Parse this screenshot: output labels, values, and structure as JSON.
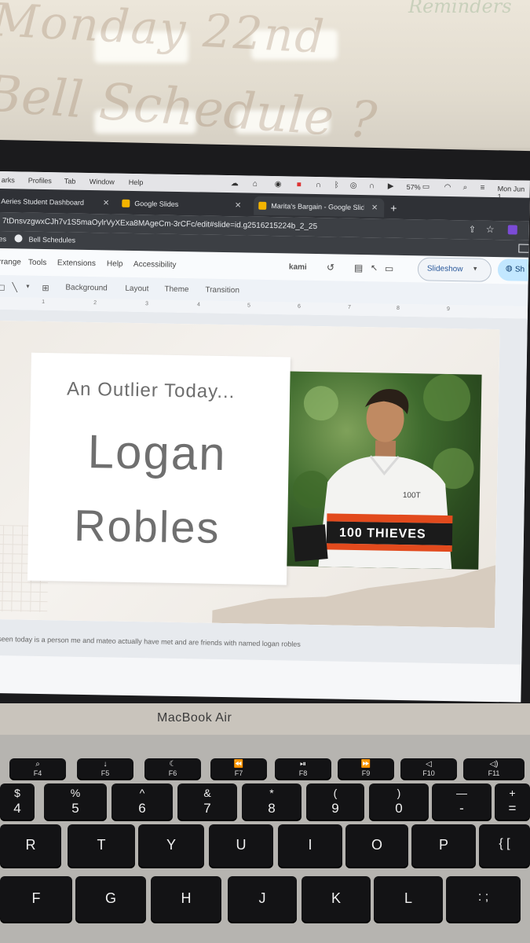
{
  "whiteboard": {
    "line1": "Monday 22nd",
    "line2": "Bell Schedule ?",
    "corner": "Reminders"
  },
  "menubar": {
    "items": [
      "arks",
      "Profiles",
      "Tab",
      "Window",
      "Help"
    ],
    "battery": "57%",
    "clock": "Mon Jun 1"
  },
  "tabs": [
    {
      "label": "Aeries Student Dashboard"
    },
    {
      "label": "Google Slides"
    },
    {
      "label": "Marita's Bargain - Google Slide"
    }
  ],
  "address_bar": {
    "url": "7tDnsvzgwxCJh7v1S5maOylrVyXExa8MAgeCm-3rCFc/edit#slide=id.g2516215224b_2_25"
  },
  "bookmarks": [
    {
      "label": "es"
    },
    {
      "label": "Bell Schedules"
    }
  ],
  "slides_menu": {
    "items": [
      "rrange",
      "Tools",
      "Extensions",
      "Help",
      "Accessibility"
    ],
    "kami": "kami",
    "slideshow": "Slideshow",
    "share": "Sh"
  },
  "toolbar": {
    "items": [
      "Background",
      "Layout",
      "Theme",
      "Transition"
    ]
  },
  "ruler": {
    "numbers": [
      "1",
      "2",
      "3",
      "4",
      "5",
      "6",
      "7",
      "8",
      "9"
    ]
  },
  "slide": {
    "subtitle": "An Outlier Today...",
    "name_first": "Logan",
    "name_last": "Robles",
    "photo_jersey_text": "100 THIEVES",
    "photo_logo_text": "100T"
  },
  "speaker_notes": "e seen today is a person me and mateo actually have met and are friends with named logan robles",
  "laptop": {
    "model": "MacBook Air"
  },
  "keyboard": {
    "fn_row": [
      {
        "glyph": "⌕",
        "label": "F4"
      },
      {
        "glyph": "↓",
        "label": "F5"
      },
      {
        "glyph": "☾",
        "label": "F6"
      },
      {
        "glyph": "⏪",
        "label": "F7"
      },
      {
        "glyph": "⏯",
        "label": "F8"
      },
      {
        "glyph": "⏩",
        "label": "F9"
      },
      {
        "glyph": "◁",
        "label": "F10"
      },
      {
        "glyph": "◁)",
        "label": "F11"
      }
    ],
    "num_row": [
      {
        "top": "$",
        "bottom": "4"
      },
      {
        "top": "%",
        "bottom": "5"
      },
      {
        "top": "^",
        "bottom": "6"
      },
      {
        "top": "&",
        "bottom": "7"
      },
      {
        "top": "*",
        "bottom": "8"
      },
      {
        "top": "(",
        "bottom": "9"
      },
      {
        "top": ")",
        "bottom": "0"
      },
      {
        "top": "—",
        "bottom": "-"
      },
      {
        "top": "+",
        "bottom": "="
      }
    ],
    "top_row": [
      "R",
      "T",
      "Y",
      "U",
      "I",
      "O",
      "P",
      "{ ["
    ],
    "home_row": [
      "F",
      "G",
      "H",
      "J",
      "K",
      "L",
      ": ;"
    ]
  }
}
